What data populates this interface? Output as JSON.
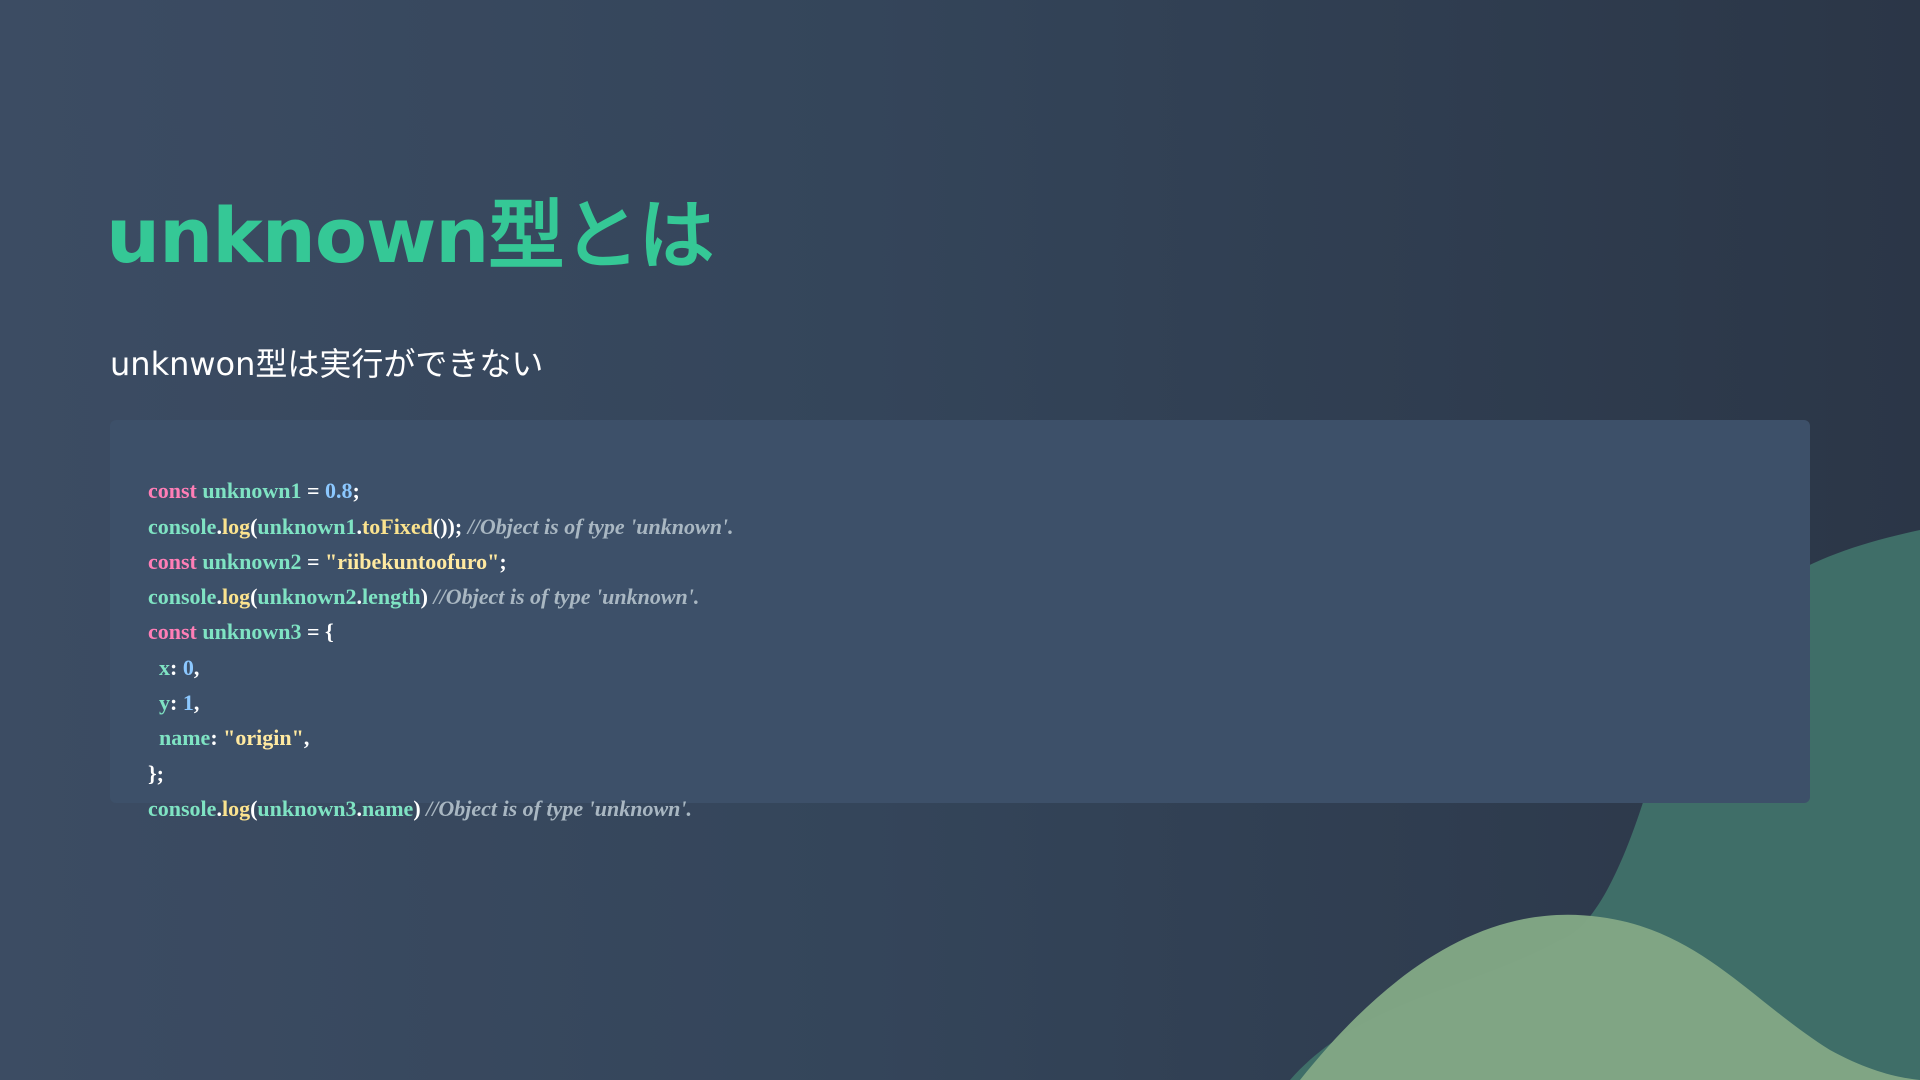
{
  "slide": {
    "title": "unknown型とは",
    "subtitle": "unknwon型は実行ができない"
  },
  "colors": {
    "background_start": "#3c4c63",
    "background_end": "#2b3647",
    "title": "#35c896",
    "code_background": "#3d5069",
    "keyword": "#ff7eb6",
    "identifier": "#7fe3c3",
    "function": "#fbe38e",
    "number": "#8cc8ff",
    "string": "#ffe9a0",
    "comment": "#a9b7c2",
    "wave_dark": "#3f6e68",
    "wave_light": "#82a785"
  },
  "code": {
    "language": "typescript",
    "lines": [
      [
        {
          "t": "kw",
          "v": "const"
        },
        {
          "t": "op",
          "v": " "
        },
        {
          "t": "id",
          "v": "unknown1"
        },
        {
          "t": "op",
          "v": " = "
        },
        {
          "t": "num",
          "v": "0.8"
        },
        {
          "t": "op",
          "v": ";"
        }
      ],
      [
        {
          "t": "id",
          "v": "console"
        },
        {
          "t": "op",
          "v": "."
        },
        {
          "t": "fn",
          "v": "log"
        },
        {
          "t": "op",
          "v": "("
        },
        {
          "t": "id",
          "v": "unknown1"
        },
        {
          "t": "op",
          "v": "."
        },
        {
          "t": "fn",
          "v": "toFixed"
        },
        {
          "t": "op",
          "v": "()); "
        },
        {
          "t": "comment",
          "v": "//Object is of type 'unknown'."
        }
      ],
      [
        {
          "t": "kw",
          "v": "const"
        },
        {
          "t": "op",
          "v": " "
        },
        {
          "t": "id",
          "v": "unknown2"
        },
        {
          "t": "op",
          "v": " = "
        },
        {
          "t": "str",
          "v": "\"riibekuntoofuro\""
        },
        {
          "t": "op",
          "v": ";"
        }
      ],
      [
        {
          "t": "id",
          "v": "console"
        },
        {
          "t": "op",
          "v": "."
        },
        {
          "t": "fn",
          "v": "log"
        },
        {
          "t": "op",
          "v": "("
        },
        {
          "t": "id",
          "v": "unknown2"
        },
        {
          "t": "op",
          "v": "."
        },
        {
          "t": "id",
          "v": "length"
        },
        {
          "t": "op",
          "v": ") "
        },
        {
          "t": "comment",
          "v": "//Object is of type 'unknown'."
        }
      ],
      [
        {
          "t": "kw",
          "v": "const"
        },
        {
          "t": "op",
          "v": " "
        },
        {
          "t": "id",
          "v": "unknown3"
        },
        {
          "t": "op",
          "v": " = {"
        }
      ],
      [
        {
          "t": "op",
          "v": "  "
        },
        {
          "t": "id",
          "v": "x"
        },
        {
          "t": "op",
          "v": ": "
        },
        {
          "t": "num",
          "v": "0"
        },
        {
          "t": "op",
          "v": ","
        }
      ],
      [
        {
          "t": "op",
          "v": "  "
        },
        {
          "t": "id",
          "v": "y"
        },
        {
          "t": "op",
          "v": ": "
        },
        {
          "t": "num",
          "v": "1"
        },
        {
          "t": "op",
          "v": ","
        }
      ],
      [
        {
          "t": "op",
          "v": "  "
        },
        {
          "t": "id",
          "v": "name"
        },
        {
          "t": "op",
          "v": ": "
        },
        {
          "t": "str",
          "v": "\"origin\""
        },
        {
          "t": "op",
          "v": ","
        }
      ],
      [
        {
          "t": "op",
          "v": "};"
        }
      ],
      [
        {
          "t": "id",
          "v": "console"
        },
        {
          "t": "op",
          "v": "."
        },
        {
          "t": "fn",
          "v": "log"
        },
        {
          "t": "op",
          "v": "("
        },
        {
          "t": "id",
          "v": "unknown3"
        },
        {
          "t": "op",
          "v": "."
        },
        {
          "t": "id",
          "v": "name"
        },
        {
          "t": "op",
          "v": ") "
        },
        {
          "t": "comment",
          "v": "//Object is of type 'unknown'."
        }
      ]
    ]
  }
}
